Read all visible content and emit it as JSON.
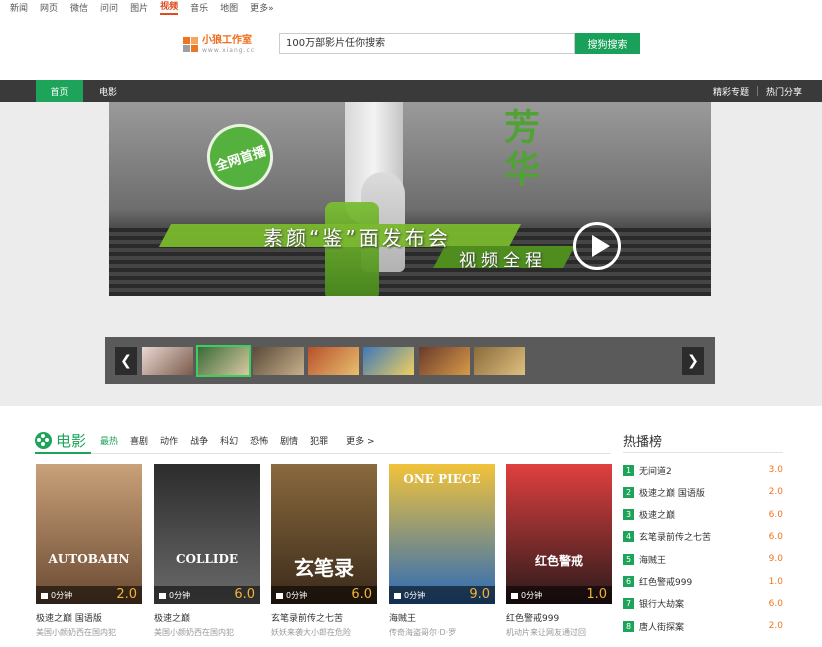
{
  "top_nav": {
    "items": [
      {
        "label": "新闻"
      },
      {
        "label": "网页"
      },
      {
        "label": "微信"
      },
      {
        "label": "问问"
      },
      {
        "label": "图片"
      },
      {
        "label": "视频",
        "active": true
      },
      {
        "label": "音乐"
      },
      {
        "label": "地图"
      },
      {
        "label": "更多»"
      }
    ]
  },
  "logo": {
    "name": "小狼工作室",
    "domain": "www.xiang.cc"
  },
  "search": {
    "placeholder": "100万部影片任你搜索",
    "button": "搜狗搜索"
  },
  "main_nav": {
    "home": "首页",
    "movie": "电影",
    "right": [
      "精彩专题",
      "热门分享"
    ]
  },
  "banner": {
    "seal": "全网首播",
    "brush_text": "芳华",
    "line1": "素颜“鉴”面发布会",
    "line2": "视频全程"
  },
  "thumbnail_strip": {
    "count": 7,
    "selected_index": 1,
    "colors": [
      [
        "#e9d8d2",
        "#7a5a4a"
      ],
      [
        "#3a6a3a",
        "#d9c9a0"
      ],
      [
        "#5a4a3a",
        "#c8b08a"
      ],
      [
        "#b8502a",
        "#e8c070"
      ],
      [
        "#3e78b8",
        "#f0d060"
      ],
      [
        "#6a3a2a",
        "#d89a4a"
      ],
      [
        "#8a6a3a",
        "#e0c080"
      ]
    ]
  },
  "movie_section": {
    "title": "电影",
    "categories": [
      "最热",
      "喜剧",
      "动作",
      "战争",
      "科幻",
      "恐怖",
      "剧情",
      "犯罪"
    ],
    "active_category": 0,
    "more": "更多 >",
    "cards": [
      {
        "name": "极速之巅 国语版",
        "desc": "美国小颜奶西在国内犯",
        "duration": "0分钟",
        "score": "2.0",
        "poster_text": "AUTOBAHN",
        "colors": [
          "#c9a17a",
          "#6b4a32"
        ]
      },
      {
        "name": "极速之巅",
        "desc": "美国小颜奶西在国内犯",
        "duration": "0分钟",
        "score": "6.0",
        "poster_text": "COLLIDE",
        "colors": [
          "#2c2c2c",
          "#6a6a6a"
        ]
      },
      {
        "name": "玄笔录前传之七苦",
        "desc": "妖妖来袭大小郎在危险",
        "duration": "0分钟",
        "score": "6.0",
        "poster_text": "玄笔录",
        "colors": [
          "#8a6a3e",
          "#3a2a1a"
        ]
      },
      {
        "name": "海贼王",
        "desc": "传奇海盗哥尔·D·罗",
        "duration": "0分钟",
        "score": "9.0",
        "poster_text": "ONE PIECE",
        "colors": [
          "#f2c33a",
          "#2a6ab8"
        ]
      },
      {
        "name": "红色警戒999",
        "desc": "机动片来让网友通过回",
        "duration": "0分钟",
        "score": "1.0",
        "poster_text": "红色警戒",
        "colors": [
          "#e04040",
          "#2a1a1a"
        ]
      }
    ]
  },
  "hot_list": {
    "title": "热播榜",
    "items": [
      {
        "rank": "1",
        "name": "无间道2",
        "score": "3.0"
      },
      {
        "rank": "2",
        "name": "极速之巅 国语版",
        "score": "2.0"
      },
      {
        "rank": "3",
        "name": "极速之巅",
        "score": "6.0"
      },
      {
        "rank": "4",
        "name": "玄笔录前传之七苦",
        "score": "6.0"
      },
      {
        "rank": "5",
        "name": "海贼王",
        "score": "9.0"
      },
      {
        "rank": "6",
        "name": "红色警戒999",
        "score": "1.0"
      },
      {
        "rank": "7",
        "name": "银行大劫案",
        "score": "6.0"
      },
      {
        "rank": "8",
        "name": "唐人街探案",
        "score": "2.0"
      }
    ]
  },
  "colors": {
    "accent_green": "#1da45a",
    "score_orange": "#f07522",
    "nav_dark": "#3a3a3a"
  }
}
